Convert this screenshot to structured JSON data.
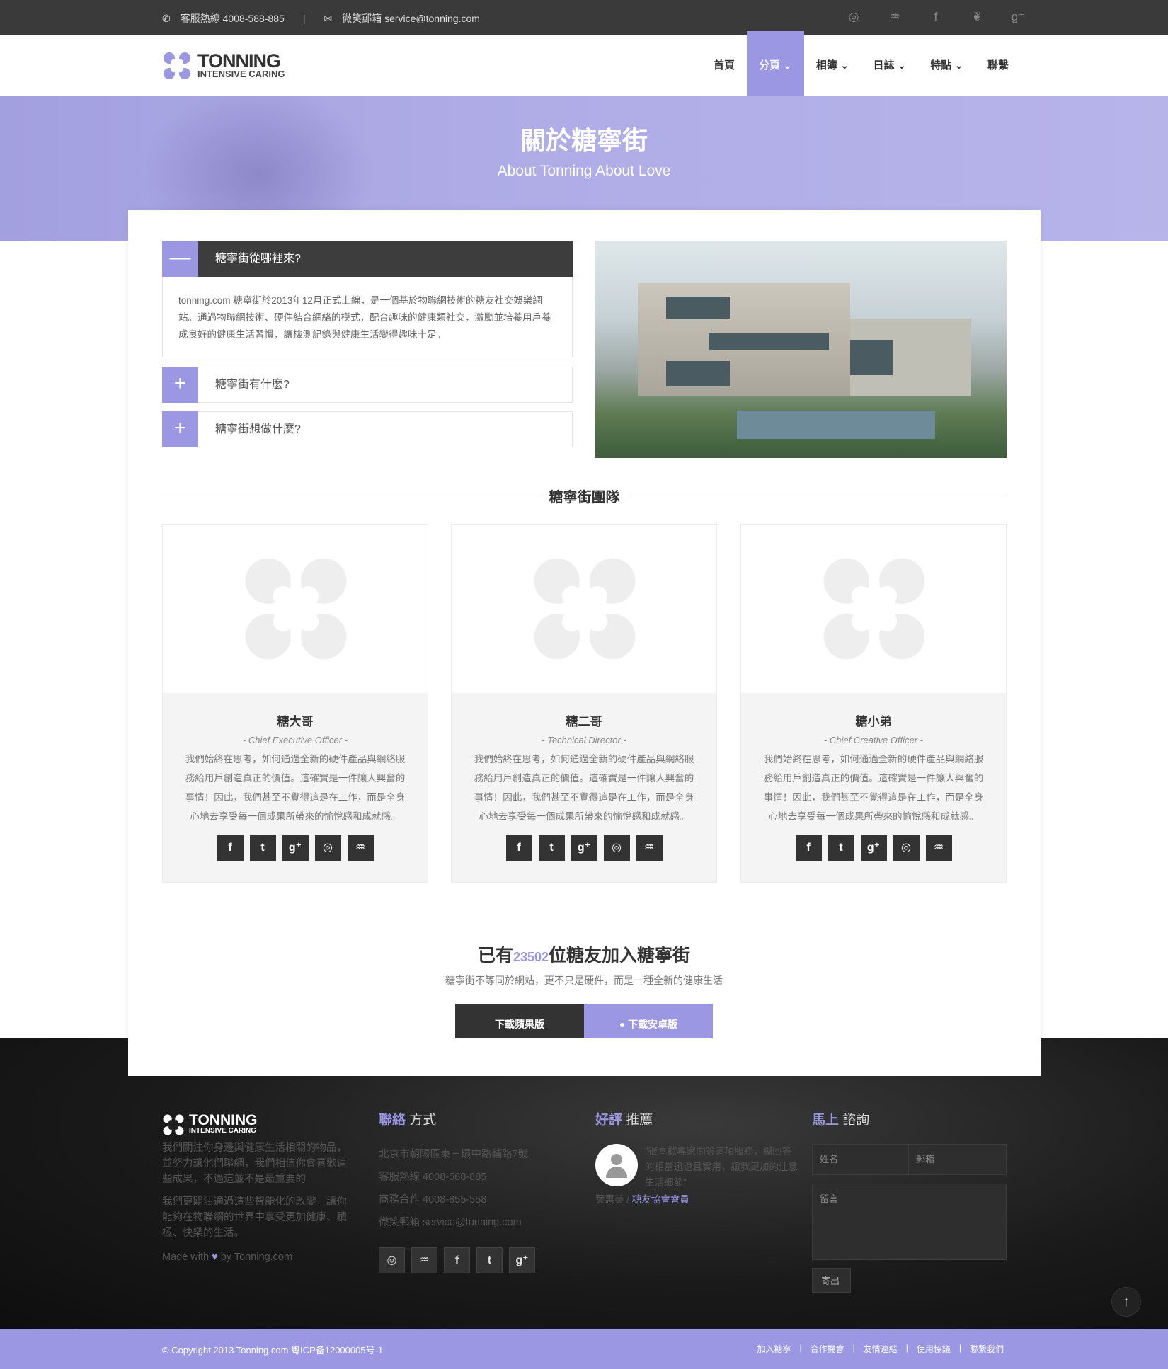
{
  "topbar": {
    "phone": "客服熱線 4008-588-885",
    "sep": "|",
    "email": "微笑郵箱 service@tonning.com"
  },
  "brand": {
    "name": "TONNING",
    "tagline": "INTENSIVE CARING",
    "accent": "#9b97e3"
  },
  "nav": [
    {
      "label": "首頁"
    },
    {
      "label": "分頁 ⌄",
      "active": true
    },
    {
      "label": "相簿 ⌄"
    },
    {
      "label": "日誌 ⌄"
    },
    {
      "label": "特點 ⌄"
    },
    {
      "label": "聯繫"
    }
  ],
  "hero": {
    "title": "關於糖寧街",
    "subtitle": "About Tonning About Love"
  },
  "accordion": [
    {
      "title": "糖寧街從哪裡來?",
      "body": "tonning.com 糖寧街於2013年12月正式上線，是一個基於物聯網技術的糖友社交娛樂網站。通過物聯網技術、硬件結合網絡的模式，配合趣味的健康類社交，激勵並培養用戶養成良好的健康生活習慣，讓檢測記錄與健康生活變得趣味十足。",
      "open": true
    },
    {
      "title": "糖寧街有什麼?"
    },
    {
      "title": "糖寧街想做什麼?"
    }
  ],
  "team_heading": "糖寧街團隊",
  "team": [
    {
      "name": "糖大哥",
      "role": "- Chief Executive Officer -",
      "desc": "我們始終在思考，如何通過全新的硬件產品與網絡服務給用戶創造真正的價值。這確實是一件讓人興奮的事情！因此，我們甚至不覺得這是在工作，而是全身心地去享受每一個成果所帶來的愉悅感和成就感。"
    },
    {
      "name": "糖二哥",
      "role": "- Technical Director -",
      "desc": "我們始終在思考，如何通過全新的硬件產品與網絡服務給用戶創造真正的價值。這確實是一件讓人興奮的事情！因此，我們甚至不覺得這是在工作，而是全身心地去享受每一個成果所帶來的愉悅感和成就感。"
    },
    {
      "name": "糖小弟",
      "role": "- Chief Creative Officer -",
      "desc": "我們始終在思考，如何通過全新的硬件產品與網絡服務給用戶創造真正的價值。這確實是一件讓人興奮的事情！因此，我們甚至不覺得這是在工作，而是全身心地去享受每一個成果所帶來的愉悅感和成就感。"
    }
  ],
  "social_icons": [
    "facebook-icon",
    "twitter-icon",
    "google-plus-icon",
    "weibo-icon",
    "renren-icon"
  ],
  "join": {
    "pre": "已有",
    "count": "23502",
    "post": "位糖友加入糖寧街",
    "sub": "糖寧街不等同於網站，更不只是硬件，而是一種全新的健康生活",
    "ios": "下載蘋果版",
    "android": "下載安卓版"
  },
  "footer": {
    "about1": "我們關注你身邊與健康生活相關的物品，並努力讓他們聯網，我們相信你會喜歡這些成果，不過這並不是最重要的",
    "about2": "我們更關注通過這些智能化的改變，讓你能夠在物聯網的世界中享受更加健康、積極、快樂的生活。",
    "made": "Made with",
    "by": "by Tonning.com",
    "contact_h1": "聯絡",
    "contact_h2": "方式",
    "address": "北京市朝陽區東三環中路輔路7號",
    "hotline": "客服熱線 4008-588-885",
    "biz": "商務合作 4008-855-558",
    "mail": "微笑郵箱 service@tonning.com",
    "testi_h1": "好評",
    "testi_h2": "推薦",
    "quote": "\"很喜歡專家問答這項服務，總回答的相當迅速且實用，讓我更加的注意生活細節\"",
    "author": "葉惠美 / ",
    "author_role": "糖友協會會員",
    "form_h1": "馬上",
    "form_h2": "諮詢",
    "name_ph": "姓名",
    "email_ph": "郵箱",
    "msg_ph": "留言",
    "send": "寄出"
  },
  "bottom": {
    "copyright": "© Copyright 2013 Tonning.com 粵ICP备12000005号-1",
    "links": [
      "加入糖寧",
      "合作機會",
      "友情連結",
      "使用協議",
      "聯繫我們"
    ]
  }
}
